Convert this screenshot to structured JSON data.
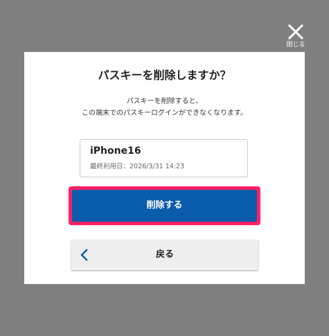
{
  "overlay": {
    "close_label": "閉じる",
    "close_icon": "close-x-icon"
  },
  "dialog": {
    "title": "パスキーを削除しますか？",
    "description_line1": "パスキーを削除すると、",
    "description_line2": "この端末でのパスキーログインができなくなります。",
    "device": {
      "name": "iPhone16",
      "last_used": "最終利用日：2026/3/31 14:23"
    },
    "delete_label": "削除する",
    "back_label": "戻る",
    "back_icon": "chevron-left-icon"
  },
  "colors": {
    "backdrop": "#7f7f7f",
    "primary": "#0a5cad",
    "highlight": "#ff1f62",
    "secondary_button": "#eeeeee"
  }
}
